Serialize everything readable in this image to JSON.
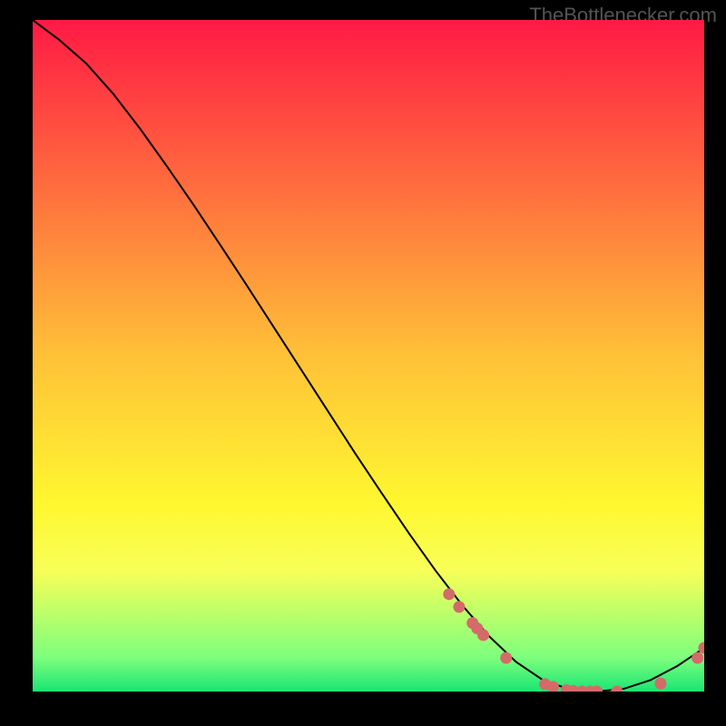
{
  "watermark": "TheBottlenecker.com",
  "chart_data": {
    "type": "line",
    "title": "",
    "xlabel": "",
    "ylabel": "",
    "xlim": [
      0,
      100
    ],
    "ylim": [
      0,
      100
    ],
    "grid": false,
    "gradient_stops": [
      {
        "offset": 0.0,
        "color": "#ff1a44"
      },
      {
        "offset": 0.5,
        "color": "#ffc138"
      },
      {
        "offset": 0.72,
        "color": "#fff730"
      },
      {
        "offset": 0.82,
        "color": "#f8ff58"
      },
      {
        "offset": 0.95,
        "color": "#7dff7d"
      },
      {
        "offset": 1.0,
        "color": "#19e574"
      }
    ],
    "series": [
      {
        "name": "curve",
        "color": "#000000",
        "x": [
          0,
          4,
          8,
          12,
          16,
          20,
          24,
          28,
          32,
          36,
          40,
          44,
          48,
          52,
          56,
          60,
          64,
          68,
          72,
          76,
          80,
          84,
          88,
          92,
          96,
          100
        ],
        "y": [
          100,
          97,
          93.5,
          89,
          83.8,
          78.2,
          72.4,
          66.4,
          60.3,
          54.1,
          47.9,
          41.7,
          35.5,
          29.5,
          23.6,
          18.0,
          12.8,
          8.2,
          4.4,
          1.7,
          0.3,
          0.0,
          0.4,
          1.7,
          3.8,
          6.5
        ]
      }
    ],
    "markers": {
      "name": "dots",
      "color": "#d46a6a",
      "radius_px": 6.5,
      "points": [
        {
          "x": 62.0,
          "y": 14.5
        },
        {
          "x": 63.5,
          "y": 12.6
        },
        {
          "x": 65.5,
          "y": 10.2
        },
        {
          "x": 66.2,
          "y": 9.4
        },
        {
          "x": 67.1,
          "y": 8.4
        },
        {
          "x": 70.5,
          "y": 5.0
        },
        {
          "x": 76.3,
          "y": 1.1
        },
        {
          "x": 77.5,
          "y": 0.7
        },
        {
          "x": 79.5,
          "y": 0.2
        },
        {
          "x": 80.5,
          "y": 0.1
        },
        {
          "x": 81.8,
          "y": 0.0
        },
        {
          "x": 83.0,
          "y": 0.0
        },
        {
          "x": 84.0,
          "y": 0.0
        },
        {
          "x": 87.0,
          "y": 0.0
        },
        {
          "x": 93.5,
          "y": 1.2
        },
        {
          "x": 99.0,
          "y": 5.0
        },
        {
          "x": 100.0,
          "y": 6.5
        }
      ]
    }
  }
}
